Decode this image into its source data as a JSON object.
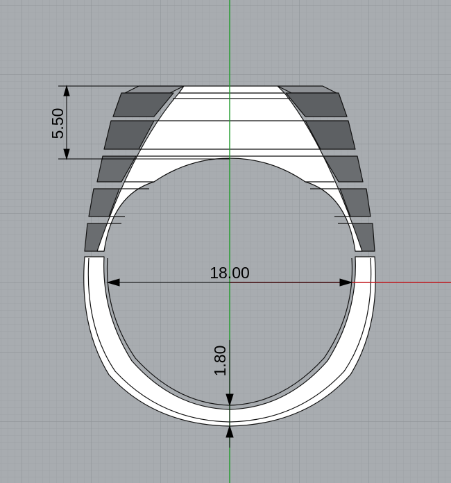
{
  "viewport": {
    "background_color": "#a8acb0",
    "grid_minor_color": "#9ea2a6",
    "grid_major_color": "#8f9397",
    "axis_x_color": "#c0181e",
    "axis_y_color": "#1e9b2a"
  },
  "model": {
    "fill_color": "#ffffff",
    "shade_dark": "#5d6063",
    "shade_mid": "#8e9195",
    "outline_color": "#111111"
  },
  "dimensions": {
    "height": "5.50",
    "inner_diameter": "18.00",
    "thickness": "1.80"
  }
}
